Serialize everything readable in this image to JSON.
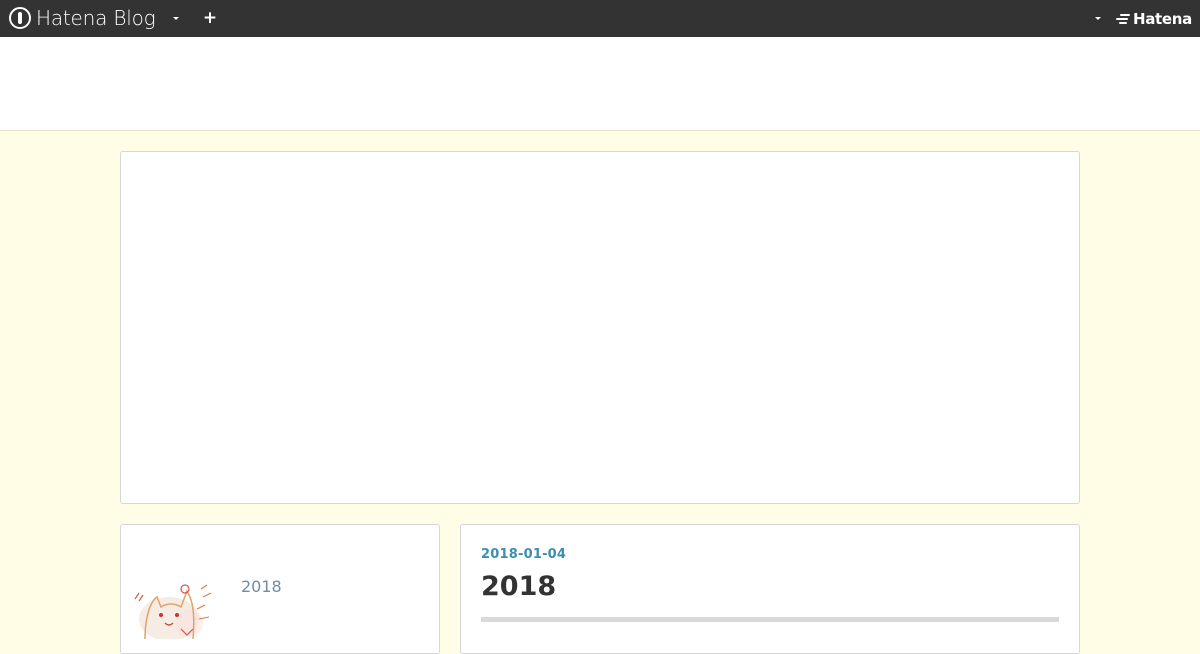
{
  "topbar": {
    "brand_text": "Hatena Blog",
    "hatena_text": "Hatena"
  },
  "sidebar": {
    "entry_link": "2018"
  },
  "entry": {
    "date": "2018-01-04",
    "title": "2018"
  },
  "colors": {
    "topbar_bg": "#333333",
    "page_bg": "#fffde5",
    "date_link": "#3b8fb0",
    "sidebar_link": "#6e8ea6"
  }
}
